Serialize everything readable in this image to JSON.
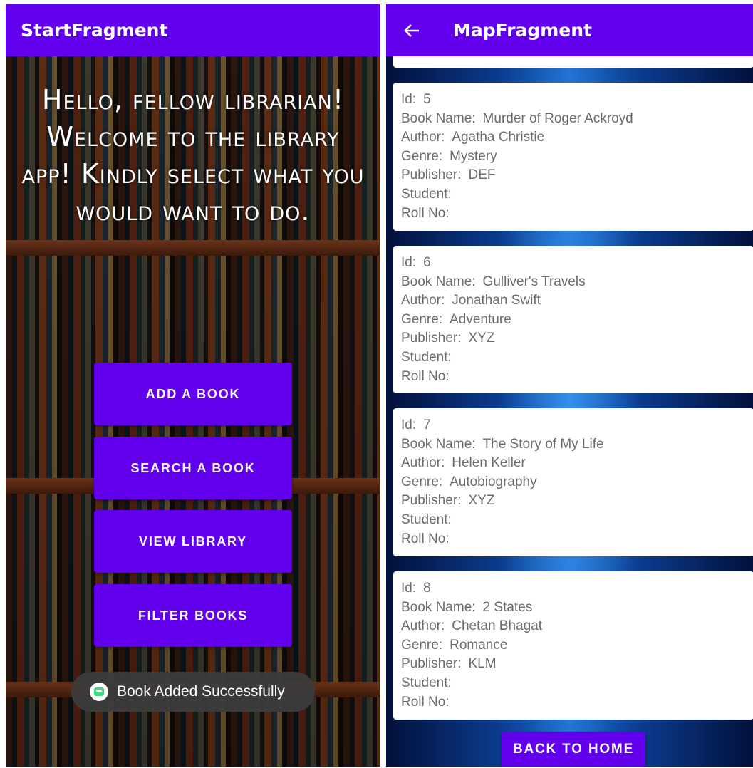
{
  "left": {
    "title": "StartFragment",
    "welcome": "Hello, fellow librarian! Welcome to the library app! Kindly select what you would want to do.",
    "buttons": {
      "add": "ADD A BOOK",
      "search": "SEARCH A BOOK",
      "view": "VIEW LIBRARY",
      "filter": "FILTER BOOKS"
    },
    "toast": "Book Added Successfully"
  },
  "right": {
    "title": "MapFragment",
    "labels": {
      "id": "Id:",
      "book_name": "Book Name:",
      "author": "Author:",
      "genre": "Genre:",
      "publisher": "Publisher:",
      "student": "Student:",
      "roll_no": "Roll No:"
    },
    "books": [
      {
        "id": "5",
        "book_name": "Murder of Roger Ackroyd",
        "author": "Agatha Christie",
        "genre": "Mystery",
        "publisher": "DEF",
        "student": "",
        "roll_no": ""
      },
      {
        "id": "6",
        "book_name": "Gulliver's Travels",
        "author": "Jonathan Swift",
        "genre": "Adventure",
        "publisher": "XYZ",
        "student": "",
        "roll_no": ""
      },
      {
        "id": "7",
        "book_name": "The Story of My Life",
        "author": "Helen Keller",
        "genre": "Autobiography",
        "publisher": "XYZ",
        "student": "",
        "roll_no": ""
      },
      {
        "id": "8",
        "book_name": "2 States",
        "author": "Chetan Bhagat",
        "genre": "Romance",
        "publisher": "KLM",
        "student": "",
        "roll_no": ""
      }
    ],
    "back_button": "BACK TO HOME"
  },
  "colors": {
    "primary": "#6200ee",
    "card_text": "#6b6b6b",
    "toast_bg": "#3c3c3c"
  },
  "icons": {
    "back": "arrow-back-icon",
    "toast_app": "app-icon"
  }
}
